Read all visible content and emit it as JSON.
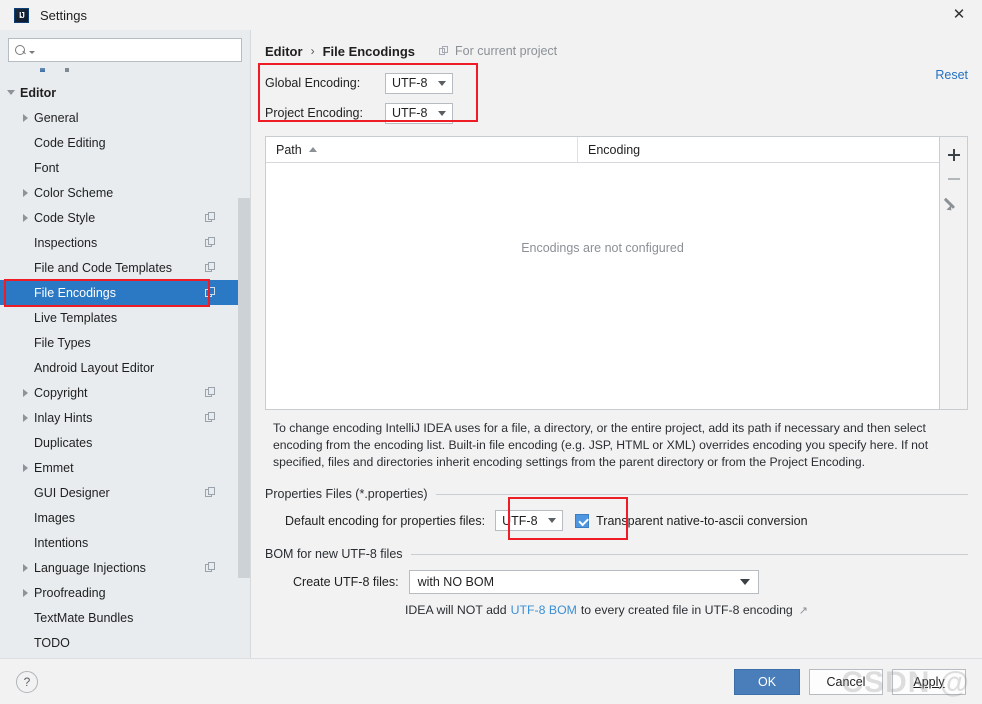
{
  "window": {
    "title": "Settings",
    "logo_icon": "intellij-idea-logo",
    "close_icon": "✕"
  },
  "search": {
    "value": "",
    "placeholder": "",
    "icon": "search-icon"
  },
  "sidebar": {
    "items": [
      {
        "label": "Editor",
        "level": 0,
        "twisty": "expanded",
        "bold": true,
        "selected": false,
        "project_icon": false
      },
      {
        "label": "General",
        "level": 1,
        "twisty": "collapsed",
        "bold": false,
        "selected": false,
        "project_icon": false
      },
      {
        "label": "Code Editing",
        "level": 1,
        "twisty": "none",
        "bold": false,
        "selected": false,
        "project_icon": false
      },
      {
        "label": "Font",
        "level": 1,
        "twisty": "none",
        "bold": false,
        "selected": false,
        "project_icon": false
      },
      {
        "label": "Color Scheme",
        "level": 1,
        "twisty": "collapsed",
        "bold": false,
        "selected": false,
        "project_icon": false
      },
      {
        "label": "Code Style",
        "level": 1,
        "twisty": "collapsed",
        "bold": false,
        "selected": false,
        "project_icon": true
      },
      {
        "label": "Inspections",
        "level": 1,
        "twisty": "none",
        "bold": false,
        "selected": false,
        "project_icon": true
      },
      {
        "label": "File and Code Templates",
        "level": 1,
        "twisty": "none",
        "bold": false,
        "selected": false,
        "project_icon": true
      },
      {
        "label": "File Encodings",
        "level": 1,
        "twisty": "none",
        "bold": false,
        "selected": true,
        "project_icon": true
      },
      {
        "label": "Live Templates",
        "level": 1,
        "twisty": "none",
        "bold": false,
        "selected": false,
        "project_icon": false
      },
      {
        "label": "File Types",
        "level": 1,
        "twisty": "none",
        "bold": false,
        "selected": false,
        "project_icon": false
      },
      {
        "label": "Android Layout Editor",
        "level": 1,
        "twisty": "none",
        "bold": false,
        "selected": false,
        "project_icon": false
      },
      {
        "label": "Copyright",
        "level": 1,
        "twisty": "collapsed",
        "bold": false,
        "selected": false,
        "project_icon": true
      },
      {
        "label": "Inlay Hints",
        "level": 1,
        "twisty": "collapsed",
        "bold": false,
        "selected": false,
        "project_icon": true
      },
      {
        "label": "Duplicates",
        "level": 1,
        "twisty": "none",
        "bold": false,
        "selected": false,
        "project_icon": false
      },
      {
        "label": "Emmet",
        "level": 1,
        "twisty": "collapsed",
        "bold": false,
        "selected": false,
        "project_icon": false
      },
      {
        "label": "GUI Designer",
        "level": 1,
        "twisty": "none",
        "bold": false,
        "selected": false,
        "project_icon": true
      },
      {
        "label": "Images",
        "level": 1,
        "twisty": "none",
        "bold": false,
        "selected": false,
        "project_icon": false
      },
      {
        "label": "Intentions",
        "level": 1,
        "twisty": "none",
        "bold": false,
        "selected": false,
        "project_icon": false
      },
      {
        "label": "Language Injections",
        "level": 1,
        "twisty": "collapsed",
        "bold": false,
        "selected": false,
        "project_icon": true
      },
      {
        "label": "Proofreading",
        "level": 1,
        "twisty": "collapsed",
        "bold": false,
        "selected": false,
        "project_icon": false
      },
      {
        "label": "TextMate Bundles",
        "level": 1,
        "twisty": "none",
        "bold": false,
        "selected": false,
        "project_icon": false
      },
      {
        "label": "TODO",
        "level": 1,
        "twisty": "none",
        "bold": false,
        "selected": false,
        "project_icon": false
      }
    ]
  },
  "breadcrumb": {
    "parent": "Editor",
    "separator": "›",
    "current": "File Encodings",
    "scope_note": "For current project",
    "scope_icon": "project-scope-icon"
  },
  "reset": {
    "label": "Reset"
  },
  "encodings": {
    "global_label": "Global Encoding:",
    "global_value": "UTF-8",
    "project_label": "Project Encoding:",
    "project_value": "UTF-8"
  },
  "table": {
    "columns": [
      "Path",
      "Encoding"
    ],
    "sort_column": "Path",
    "sort_direction": "asc",
    "rows": [],
    "empty_message": "Encodings are not configured",
    "toolbar": {
      "add": "add-icon",
      "remove": "remove-icon",
      "edit": "edit-pencil-icon"
    }
  },
  "description": "To change encoding IntelliJ IDEA uses for a file, a directory, or the entire project, add its path if necessary and then select encoding from the encoding list. Built-in file encoding (e.g. JSP, HTML or XML) overrides encoding you specify here. If not specified, files and directories inherit encoding settings from the parent directory or from the Project Encoding.",
  "properties_group": {
    "title": "Properties Files (*.properties)",
    "default_encoding_label": "Default encoding for properties files:",
    "default_encoding_value": "UTF-8",
    "transparent_checkbox_label": "Transparent native-to-ascii conversion",
    "transparent_checked": true
  },
  "bom_group": {
    "title": "BOM for new UTF-8 files",
    "create_label": "Create UTF-8 files:",
    "create_value": "with NO BOM",
    "hint_prefix": "IDEA will NOT add",
    "hint_link": "UTF-8 BOM",
    "hint_suffix": "to every created file in UTF-8 encoding",
    "external_link_icon": "↗"
  },
  "footer": {
    "help_label": "?",
    "ok_label": "OK",
    "cancel_label": "Cancel",
    "apply_label": "Apply"
  },
  "watermark": {
    "text": "CSDN @"
  },
  "colors": {
    "accent": "#2b79c4",
    "link": "#2470c0",
    "highlight_box": "#ee1c25",
    "primary_button": "#4a7ebb",
    "sidebar_bg": "#e8ecef"
  }
}
